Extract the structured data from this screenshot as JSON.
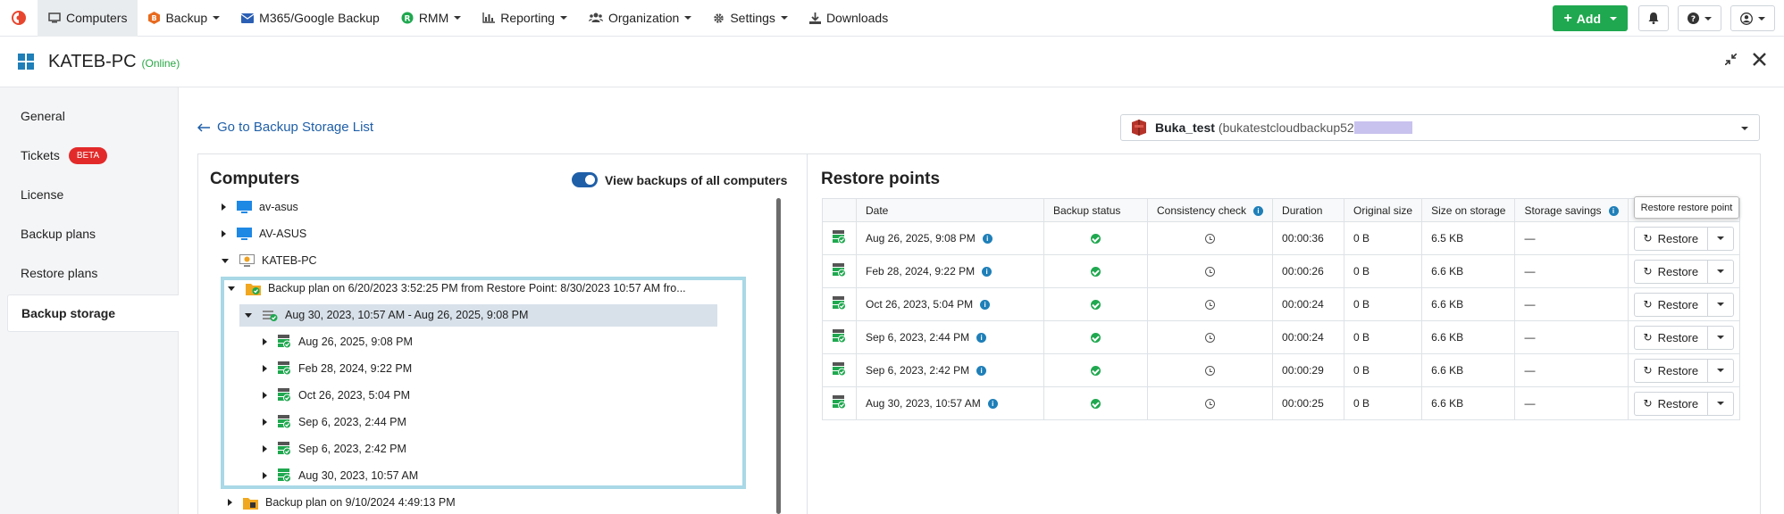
{
  "nav": {
    "items": [
      {
        "label": "Computers",
        "icon": "monitor-icon",
        "dropdown": false,
        "active": true
      },
      {
        "label": "Backup",
        "icon": "backup-icon",
        "dropdown": true
      },
      {
        "label": "M365/Google Backup",
        "icon": "envelope-icon",
        "dropdown": false
      },
      {
        "label": "RMM",
        "icon": "rmm-icon",
        "dropdown": true
      },
      {
        "label": "Reporting",
        "icon": "bar-chart-icon",
        "dropdown": true
      },
      {
        "label": "Organization",
        "icon": "users-icon",
        "dropdown": true
      },
      {
        "label": "Settings",
        "icon": "gear-icon",
        "dropdown": true
      },
      {
        "label": "Downloads",
        "icon": "download-icon",
        "dropdown": false
      }
    ],
    "add_label": "Add",
    "colors": {
      "add": "#1fa84f",
      "brand": "#e8462f"
    }
  },
  "header": {
    "title": "KATEB-PC",
    "status": "(Online)"
  },
  "sidebar": {
    "items": [
      {
        "label": "General"
      },
      {
        "label": "Tickets",
        "badge": "BETA"
      },
      {
        "label": "License"
      },
      {
        "label": "Backup plans"
      },
      {
        "label": "Restore plans"
      },
      {
        "label": "Backup storage",
        "active": true
      }
    ]
  },
  "main": {
    "back_link": "Go to Backup Storage List",
    "storage": {
      "name": "Buka_test",
      "detail": "(bukatestcloudbackup52"
    }
  },
  "computers": {
    "title": "Computers",
    "toggle_label": "View backups of all computers",
    "toggle_on": true,
    "tree": [
      {
        "label": "av-asus",
        "icon": "monitor-icon",
        "expanded": false
      },
      {
        "label": "AV-ASUS",
        "icon": "monitor-icon",
        "expanded": false
      },
      {
        "label": "KATEB-PC",
        "icon": "computer-icon",
        "expanded": true
      },
      {
        "label": "Backup plan on 6/20/2023 3:52:25 PM from Restore Point: 8/30/2023 10:57 AM fro...",
        "icon": "backup-plan-icon",
        "expanded": true
      },
      {
        "label": "Aug 30, 2023, 10:57 AM - Aug 26, 2025, 9:08 PM",
        "icon": "restore-chain-icon",
        "expanded": true
      },
      {
        "label": "Aug 26, 2025, 9:08 PM",
        "icon": "restore-point-icon"
      },
      {
        "label": "Feb 28, 2024, 9:22 PM",
        "icon": "restore-point-icon"
      },
      {
        "label": "Oct 26, 2023, 5:04 PM",
        "icon": "restore-point-icon"
      },
      {
        "label": "Sep 6, 2023, 2:44 PM",
        "icon": "restore-point-icon"
      },
      {
        "label": "Sep 6, 2023, 2:42 PM",
        "icon": "restore-point-icon"
      },
      {
        "label": "Aug 30, 2023, 10:57 AM",
        "icon": "restore-point-icon"
      },
      {
        "label": "Backup plan on 9/10/2024 4:49:13 PM",
        "icon": "backup-plan-icon",
        "expanded": false
      }
    ]
  },
  "restore_points": {
    "title": "Restore points",
    "columns": [
      "Date",
      "Backup status",
      "Consistency check",
      "Duration",
      "Original size",
      "Size on storage",
      "Storage savings"
    ],
    "tooltip": "Restore restore point",
    "restore_label": "Restore",
    "rows": [
      {
        "date": "Aug 26, 2025, 9:08 PM",
        "duration": "00:00:36",
        "original": "0 B",
        "storage": "6.5 KB",
        "savings": "—"
      },
      {
        "date": "Feb 28, 2024, 9:22 PM",
        "duration": "00:00:26",
        "original": "0 B",
        "storage": "6.6 KB",
        "savings": "—"
      },
      {
        "date": "Oct 26, 2023, 5:04 PM",
        "duration": "00:00:24",
        "original": "0 B",
        "storage": "6.6 KB",
        "savings": "—"
      },
      {
        "date": "Sep 6, 2023, 2:44 PM",
        "duration": "00:00:24",
        "original": "0 B",
        "storage": "6.6 KB",
        "savings": "—"
      },
      {
        "date": "Sep 6, 2023, 2:42 PM",
        "duration": "00:00:29",
        "original": "0 B",
        "storage": "6.6 KB",
        "savings": "—"
      },
      {
        "date": "Aug 30, 2023, 10:57 AM",
        "duration": "00:00:25",
        "original": "0 B",
        "storage": "6.6 KB",
        "savings": "—"
      }
    ]
  }
}
